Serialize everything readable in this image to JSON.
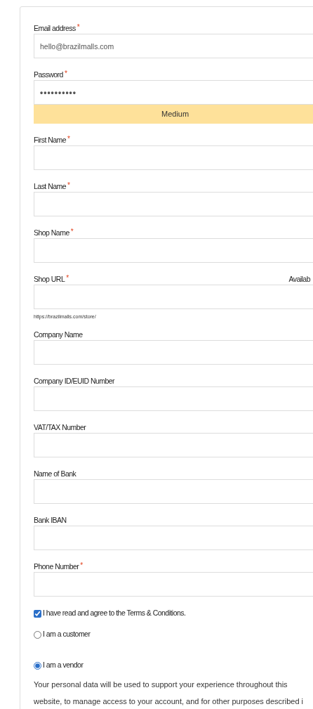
{
  "fields": [
    {
      "label": "Email address",
      "required_mark": "*",
      "kind": "text",
      "value": "hello@brazilmalls.com"
    },
    {
      "label": "Password",
      "required_mark": "*",
      "kind": "password",
      "value": "••••••••••",
      "strength": "Medium"
    },
    {
      "label": "First Name",
      "required_mark": "*",
      "kind": "text"
    },
    {
      "label": "Last Name",
      "required_mark": "*",
      "kind": "text"
    },
    {
      "label": "Shop Name",
      "required_mark": "*",
      "kind": "text"
    },
    {
      "label": "Shop URL",
      "required_mark": "*",
      "kind": "text",
      "aside": "Availab",
      "hint": "https://brazilmalls.com/store/"
    },
    {
      "label": "Company Name",
      "kind": "text"
    },
    {
      "label": "Company ID/EUID Number",
      "kind": "text"
    },
    {
      "label": "VAT/TAX Number",
      "kind": "text"
    },
    {
      "label": "Name of Bank",
      "kind": "text"
    },
    {
      "label": "Bank IBAN",
      "kind": "text"
    },
    {
      "label": "Phone Number",
      "required_mark": "*",
      "kind": "text"
    }
  ],
  "terms": {
    "label": "I have read and agree to the Terms & Conditions.",
    "checked": true
  },
  "roles": [
    {
      "label": "I am a customer",
      "selected": false
    },
    {
      "label": "I am a vendor",
      "selected": true
    }
  ],
  "privacy": "Your personal data will be used to support your experience throughout this website, to manage access to your account, and for other purposes described i"
}
